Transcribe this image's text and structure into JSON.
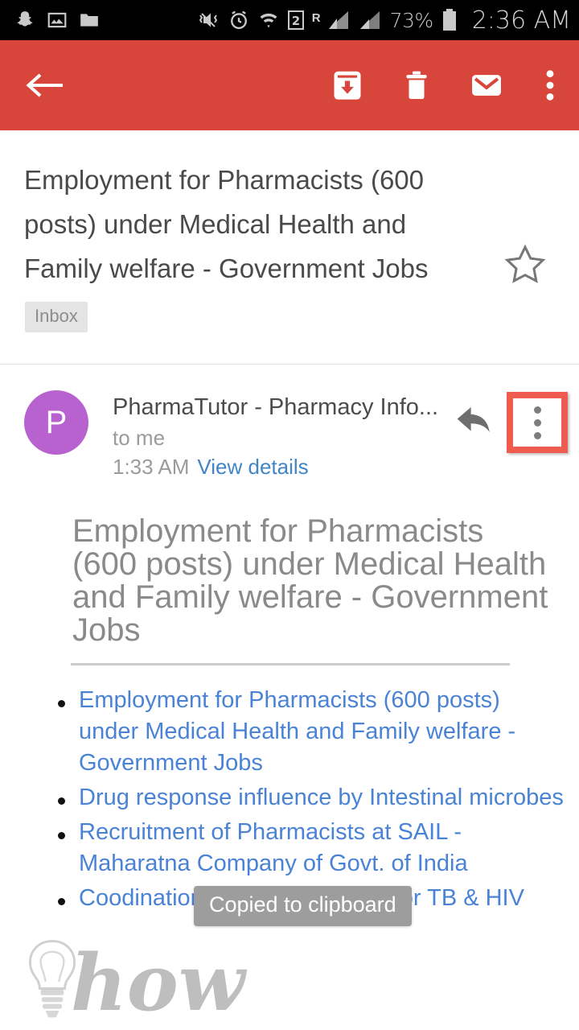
{
  "statusbar": {
    "left_icons": [
      "snapchat-icon",
      "gallery-icon",
      "folder-icon"
    ],
    "right_icons": [
      "mute-vibrate-icon",
      "alarm-icon",
      "wifi-icon",
      "dual-sim-icon",
      "roaming-icon",
      "signal-1-icon",
      "signal-2-icon"
    ],
    "sim_label": "2",
    "roaming_label": "R",
    "battery_percent": "73%",
    "time": "2:36 AM"
  },
  "appbar": {
    "back_icon": "back-arrow-icon",
    "archive_icon": "archive-icon",
    "delete_icon": "delete-icon",
    "unread_icon": "mark-unread-icon",
    "overflow_icon": "overflow-menu-icon",
    "color": "#d8453a"
  },
  "subject": {
    "text": "Employment for Pharmacists (600 posts) under Medical Health and Family welfare - Government Jobs",
    "label": "Inbox",
    "star_icon": "star-outline-icon"
  },
  "sender": {
    "avatar_letter": "P",
    "avatar_color": "#b862cf",
    "name": "PharmaTutor - Pharmacy Info...",
    "recipient": "to me",
    "time": "1:33 AM",
    "details_link": "View details",
    "reply_icon": "reply-icon",
    "menu_icon": "overflow-menu-icon",
    "highlight_color": "#ef5b4c"
  },
  "body": {
    "title": "Employment for Pharmacists (600 posts) under Medical Health and Family welfare - Government Jobs",
    "links": [
      "Employment for Pharmacists (600 posts) under Medical Health and Family welfare - Government Jobs",
      "Drug response influence by Intestinal microbes",
      "Recruitment of Pharmacists at SAIL - Maharatna Company of Govt. of India",
      "Coodination treatment require for TB & HIV"
    ],
    "link_color": "#4a83d6"
  },
  "toast": {
    "message": "Copied to clipboard"
  },
  "watermark": {
    "text": "how",
    "icon": "lightbulb-icon"
  }
}
